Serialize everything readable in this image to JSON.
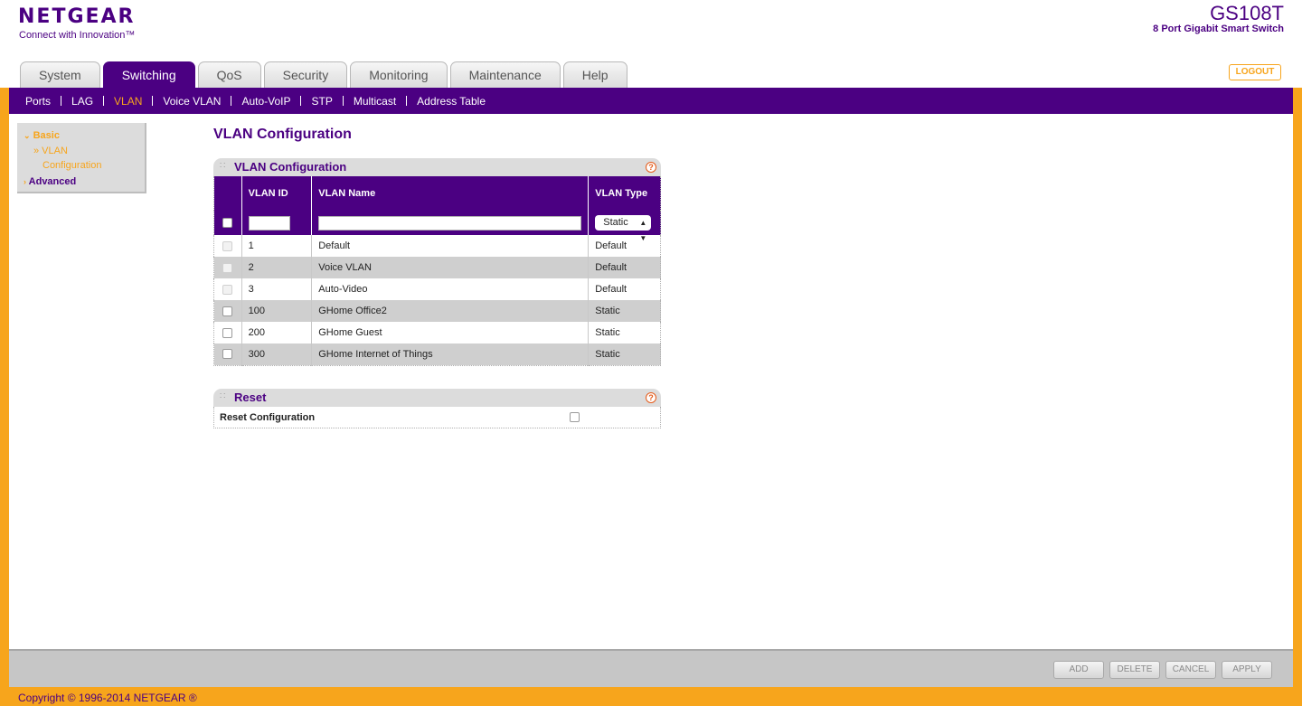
{
  "brand": {
    "logo_text": "NETGEAR",
    "tagline": "Connect with Innovation™",
    "model": "GS108T",
    "model_desc": "8 Port Gigabit Smart Switch"
  },
  "tabs": [
    {
      "label": "System"
    },
    {
      "label": "Switching",
      "active": true
    },
    {
      "label": "QoS"
    },
    {
      "label": "Security"
    },
    {
      "label": "Monitoring"
    },
    {
      "label": "Maintenance"
    },
    {
      "label": "Help"
    }
  ],
  "logout_label": "LOGOUT",
  "subnav": [
    {
      "label": "Ports"
    },
    {
      "label": "LAG"
    },
    {
      "label": "VLAN",
      "active": true
    },
    {
      "label": "Voice VLAN"
    },
    {
      "label": "Auto-VoIP"
    },
    {
      "label": "STP"
    },
    {
      "label": "Multicast"
    },
    {
      "label": "Address Table"
    }
  ],
  "sidenav": {
    "basic": "Basic",
    "vlan_item_line1": "» VLAN",
    "vlan_item_line2": "Configuration",
    "advanced": "Advanced"
  },
  "page_title": "VLAN Configuration",
  "vlan_panel": {
    "title": "VLAN Configuration",
    "columns": [
      "VLAN ID",
      "VLAN Name",
      "VLAN Type"
    ],
    "new_vlan_type": "Static",
    "rows": [
      {
        "id": "1",
        "name": "Default",
        "type": "Default",
        "editable": false
      },
      {
        "id": "2",
        "name": "Voice VLAN",
        "type": "Default",
        "editable": false
      },
      {
        "id": "3",
        "name": "Auto-Video",
        "type": "Default",
        "editable": false
      },
      {
        "id": "100",
        "name": "GHome Office2",
        "type": "Static",
        "editable": true
      },
      {
        "id": "200",
        "name": "GHome Guest",
        "type": "Static",
        "editable": true
      },
      {
        "id": "300",
        "name": "GHome Internet of Things",
        "type": "Static",
        "editable": true
      }
    ]
  },
  "reset_panel": {
    "title": "Reset",
    "label": "Reset Configuration"
  },
  "buttons": {
    "add": "ADD",
    "delete": "DELETE",
    "cancel": "CANCEL",
    "apply": "APPLY"
  },
  "copyright": "Copyright © 1996-2014 NETGEAR ®",
  "colors": {
    "brand_purple": "#4b0082",
    "accent_orange": "#f7a51c"
  }
}
